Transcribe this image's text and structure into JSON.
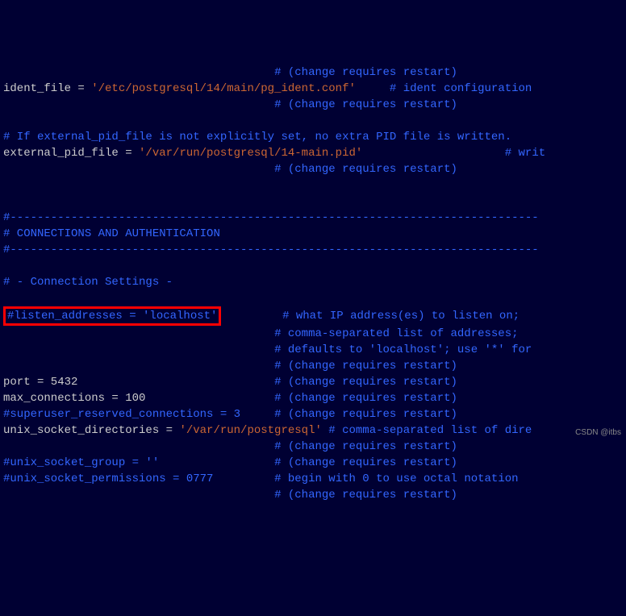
{
  "lines": {
    "l0_pad": "                                        ",
    "l0_b": "# (change requires restart)",
    "l1_a": "ident_file = ",
    "l1_b": "'/etc/postgresql/14/main/pg_ident.conf'",
    "l1_c": "     ",
    "l1_d": "# ident configuration ",
    "l2_pad": "                                        ",
    "l2_b": "# (change requires restart)",
    "l4": "# If external_pid_file is not explicitly set, no extra PID file is written.",
    "l5_a": "external_pid_file = ",
    "l5_b": "'/var/run/postgresql/14-main.pid'",
    "l5_c": "                     ",
    "l5_d": "# writ",
    "l6_pad": "                                        ",
    "l6_b": "# (change requires restart)",
    "l9": "#------------------------------------------------------------------------------",
    "l10": "# CONNECTIONS AND AUTHENTICATION",
    "l11": "#------------------------------------------------------------------------------",
    "l13": "# - Connection Settings -",
    "l15_box": "#listen_addresses = 'localhost'",
    "l15_pad": "         ",
    "l15_b": "# what IP address(es) to listen on;",
    "l16_pad": "                                        ",
    "l16_b": "# comma-separated list of addresses;",
    "l17_pad": "                                        ",
    "l17_b": "# defaults to 'localhost'; use '*' for",
    "l18_pad": "                                        ",
    "l18_b": "# (change requires restart)",
    "l19_a": "port = 5432",
    "l19_pad": "                             ",
    "l19_b": "# (change requires restart)",
    "l20_a": "max_connections = 100",
    "l20_pad": "                   ",
    "l20_b": "# (change requires restart)",
    "l21_a": "#superuser_reserved_connections = 3",
    "l21_pad": "     ",
    "l21_b": "# (change requires restart)",
    "l22_a": "unix_socket_directories = ",
    "l22_b": "'/var/run/postgresql'",
    "l22_c": " ",
    "l22_d": "# comma-separated list of dire",
    "l23_pad": "                                        ",
    "l23_b": "# (change requires restart)",
    "l24_a": "#unix_socket_group = ''",
    "l24_pad": "                 ",
    "l24_b": "# (change requires restart)",
    "l25_a": "#unix_socket_permissions = 0777",
    "l25_pad": "         ",
    "l25_b": "# begin with 0 to use octal notation",
    "l26_pad": "                                        ",
    "l26_b": "# (change requires restart)"
  },
  "watermark": "CSDN @itbs"
}
